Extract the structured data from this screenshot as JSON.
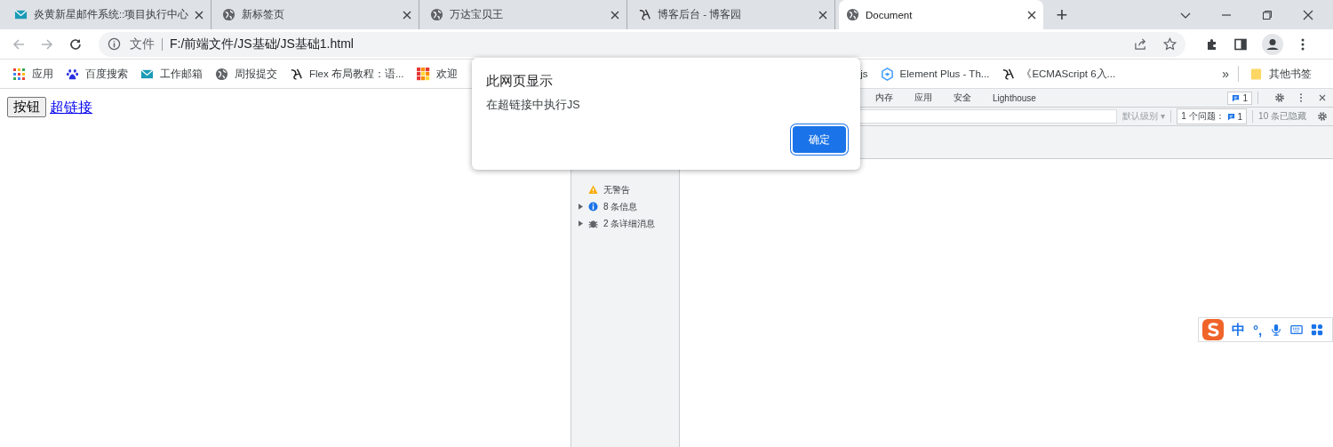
{
  "tabs": [
    {
      "title": "炎黄新星邮件系统::项目执行中心",
      "kind": "mail",
      "selected": false
    },
    {
      "title": "新标签页",
      "kind": "globe",
      "selected": false
    },
    {
      "title": "万达宝贝王",
      "kind": "globe",
      "selected": false
    },
    {
      "title": "博客后台 - 博客园",
      "kind": "brush",
      "selected": false
    },
    {
      "title": "Document",
      "kind": "globe",
      "selected": true
    }
  ],
  "new_tab": "+",
  "address": {
    "scheme": "文件",
    "url": "F:/前端文件/JS基础/JS基础1.html"
  },
  "bookmarks_left": [
    {
      "label": "应用",
      "kind": "apps"
    },
    {
      "label": "百度搜索",
      "kind": "paw"
    },
    {
      "label": "工作邮箱",
      "kind": "mail"
    },
    {
      "label": "周报提交",
      "kind": "globe"
    },
    {
      "label": "Flex 布局教程：语...",
      "kind": "brush"
    },
    {
      "label": "欢迎",
      "kind": "tiles"
    }
  ],
  "bookmarks_right": [
    {
      "label": "js",
      "kind": "none"
    },
    {
      "label": "Element Plus - Th...",
      "kind": "hexagon"
    },
    {
      "label": "《ECMAScript 6入...",
      "kind": "brush"
    }
  ],
  "bookmarks_more": "»",
  "other_bookmarks": "其他书签",
  "page": {
    "button": "按钮",
    "link": "超链接"
  },
  "dialog": {
    "title": "此网页显示",
    "message": "在超链接中执行JS",
    "ok": "确定"
  },
  "devtools": {
    "tabs": [
      "内存",
      "应用",
      "安全",
      "Lighthouse"
    ],
    "issues_badge": "1",
    "filter_level": "默认级别 ▾",
    "issues_label": "1 个问题：",
    "issues_count": "1",
    "hidden": "10 条已隐藏",
    "sidebar": [
      {
        "label": "无警告",
        "kind": "warning",
        "expandable": false
      },
      {
        "label": "8 条信息",
        "kind": "info",
        "expandable": true
      },
      {
        "label": "2 条详细消息",
        "kind": "verbose",
        "expandable": true
      }
    ]
  },
  "ime": {
    "mode": "中",
    "punct": "°,"
  }
}
